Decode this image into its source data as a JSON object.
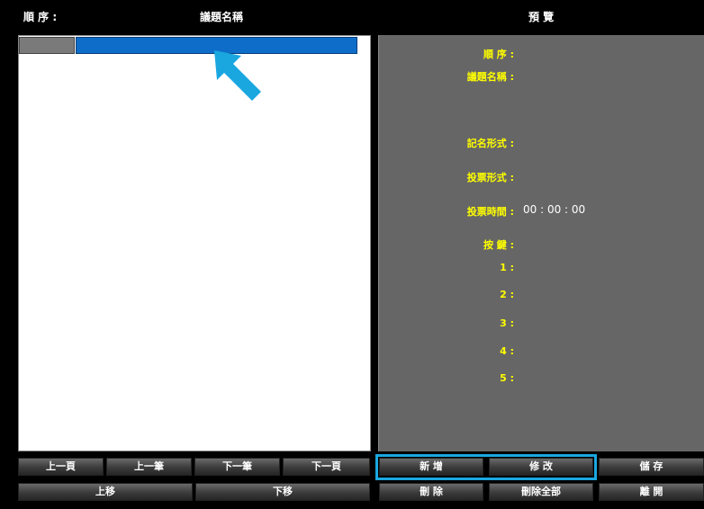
{
  "header": {
    "order_label": "順 序 :",
    "title_label": "議題名稱",
    "preview_label": "預 覽"
  },
  "preview": {
    "order": "順 序 :",
    "title": "議題名稱 :",
    "naming": "記名形式 :",
    "vote_type": "投票形式 :",
    "vote_time": "投票時間 :",
    "vote_time_value": "00 : 00 : 00",
    "keys_label": "按 鍵 :",
    "keys": [
      "1 :",
      "2 :",
      "3 :",
      "4 :",
      "5 :"
    ]
  },
  "buttons": {
    "prev_page": "上一頁",
    "prev_item": "上一筆",
    "next_item": "下一筆",
    "next_page": "下一頁",
    "move_up": "上移",
    "move_down": "下移",
    "add": "新 增",
    "modify": "修 改",
    "save": "儲 存",
    "delete": "刪 除",
    "delete_all": "刪除全部",
    "leave": "離 開"
  },
  "colors": {
    "selection": "#0e6dc9",
    "highlight": "#1aa7e0",
    "label": "#ffff00"
  },
  "icons": {
    "pointer": "arrow-icon"
  }
}
